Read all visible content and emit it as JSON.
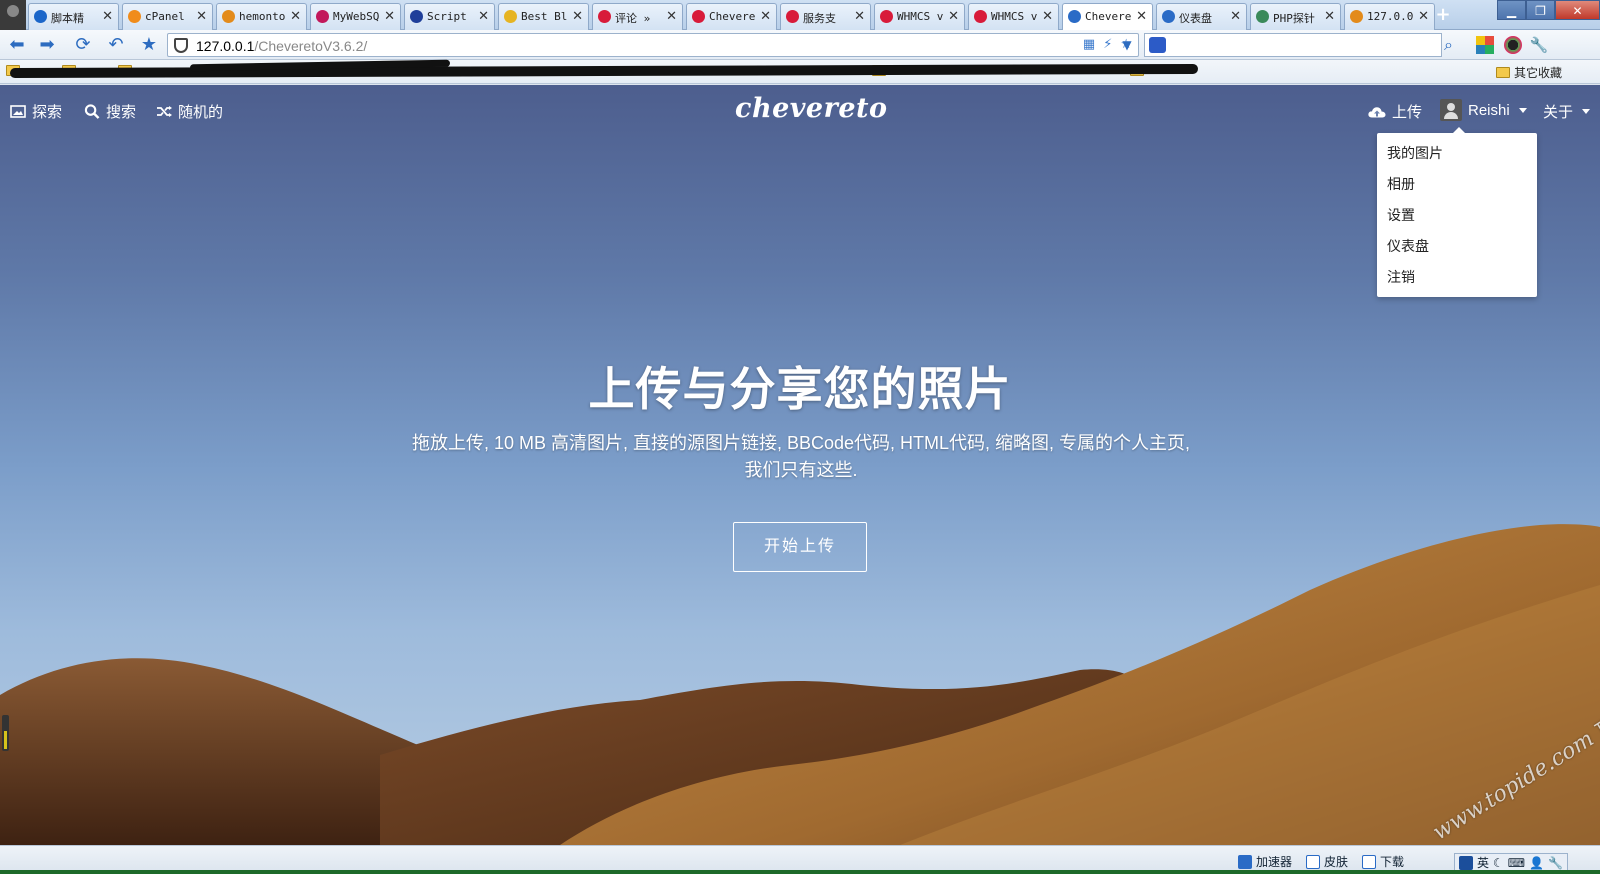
{
  "browser": {
    "tabs": [
      {
        "label": "脚本精",
        "icon_color": "#1b66c9"
      },
      {
        "label": "cPanel",
        "icon_color": "#f08c1b"
      },
      {
        "label": "hemonto",
        "icon_color": "#e38b1b"
      },
      {
        "label": "MyWebSQ",
        "icon_color": "#c2185b"
      },
      {
        "label": "Script",
        "icon_color": "#1f3f9a"
      },
      {
        "label": "Best Bl",
        "icon_color": "#e6b422"
      },
      {
        "label": "评论 »",
        "icon_color": "#d81b3a"
      },
      {
        "label": "Chevere",
        "icon_color": "#d81b3a"
      },
      {
        "label": "服务支",
        "icon_color": "#d81b3a"
      },
      {
        "label": "WHMCS v",
        "icon_color": "#d81b3a"
      },
      {
        "label": "WHMCS v",
        "icon_color": "#d81b3a"
      },
      {
        "label": "Chevere",
        "icon_color": "#2a6bc6",
        "active": true
      },
      {
        "label": "仪表盘",
        "icon_color": "#2a6bc6"
      },
      {
        "label": "PHP探针",
        "icon_color": "#3a8a5a"
      },
      {
        "label": "127.0.0",
        "icon_color": "#e38b1b"
      }
    ],
    "address": {
      "host": "127.0.0.1",
      "path": "/CheveretoV3.6.2/"
    },
    "search_placeholder": "",
    "bookmarks": {
      "other_label": "其它收藏"
    }
  },
  "site": {
    "nav": {
      "explore": "探索",
      "search": "搜索",
      "random": "随机的",
      "brand": "chevereto",
      "upload": "上传",
      "user": "Reishi",
      "about": "关于"
    },
    "user_menu": [
      "我的图片",
      "相册",
      "设置",
      "仪表盘",
      "注销"
    ],
    "hero": {
      "title": "上传与分享您的照片",
      "description": "拖放上传, 10 MB 高清图片, 直接的源图片链接, BBCode代码, HTML代码, 缩略图, 专属的个人主页, 我们只有这些.",
      "cta": "开始上传"
    }
  },
  "statusbar": {
    "accelerator": "加速器",
    "skin": "皮肤",
    "download": "下载",
    "ime": "英"
  },
  "watermark": {
    "url": "www.topide.com",
    "label": "顶点网"
  }
}
